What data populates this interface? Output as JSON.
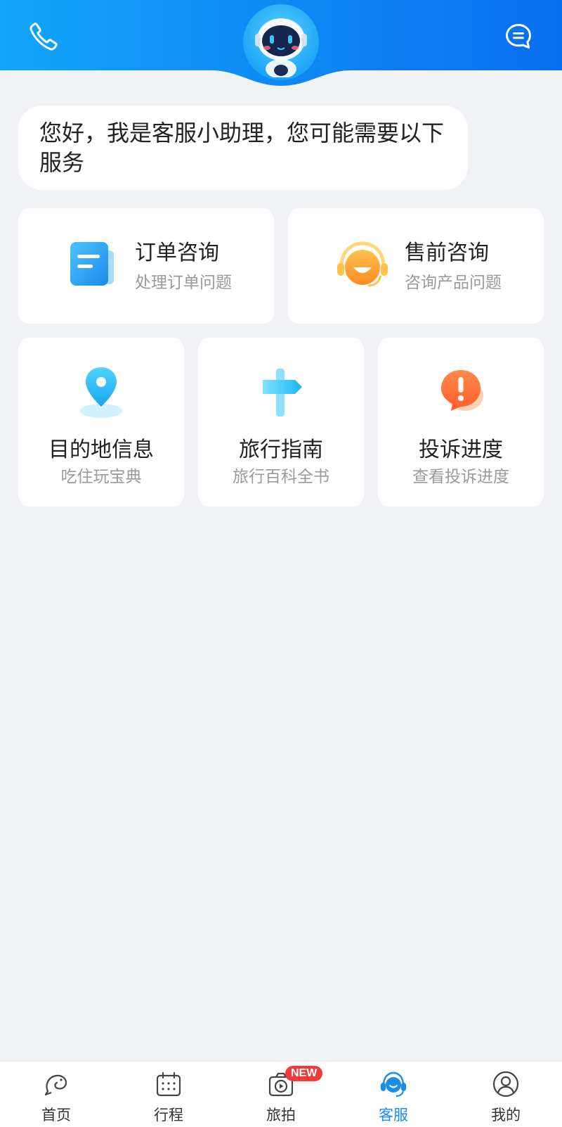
{
  "header": {
    "phone_icon": "phone-icon",
    "chat_icon": "chat-bubble-icon",
    "avatar_icon": "robot-avatar-icon",
    "gradient_from": "#0ea2f8",
    "gradient_to": "#0a6ff0"
  },
  "greeting": {
    "text": "您好，我是客服小助理，您可能需要以下服务"
  },
  "services_primary": [
    {
      "title": "订单咨询",
      "subtitle": "处理订单问题",
      "icon": "document-icon"
    },
    {
      "title": "售前咨询",
      "subtitle": "咨询产品问题",
      "icon": "headset-smile-icon"
    }
  ],
  "services_secondary": [
    {
      "title": "目的地信息",
      "subtitle": "吃住玩宝典",
      "icon": "location-pin-icon"
    },
    {
      "title": "旅行指南",
      "subtitle": "旅行百科全书",
      "icon": "signpost-icon"
    },
    {
      "title": "投诉进度",
      "subtitle": "查看投诉进度",
      "icon": "alert-bubble-icon"
    }
  ],
  "tabbar": {
    "items": [
      {
        "label": "首页",
        "icon": "dolphin-home-icon"
      },
      {
        "label": "行程",
        "icon": "calendar-icon"
      },
      {
        "label": "旅拍",
        "icon": "video-camera-icon",
        "badge": "NEW"
      },
      {
        "label": "客服",
        "icon": "customer-service-icon",
        "active": true
      },
      {
        "label": "我的",
        "icon": "user-icon"
      }
    ],
    "active_color": "#1a8de9"
  }
}
